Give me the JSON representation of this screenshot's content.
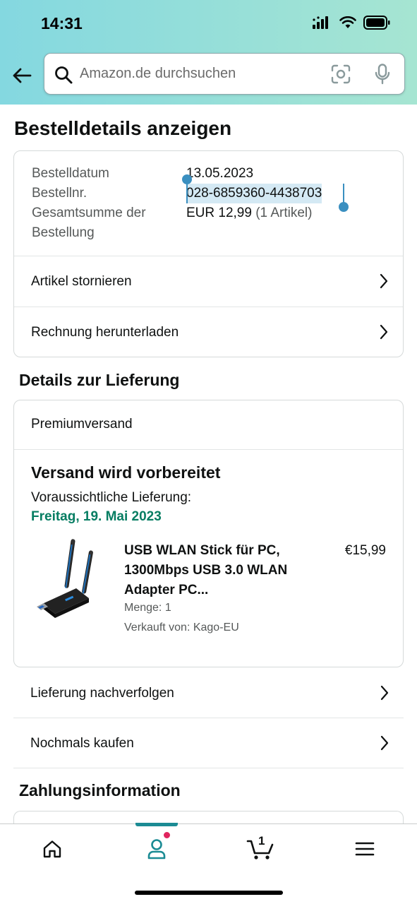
{
  "status_bar": {
    "time": "14:31"
  },
  "search": {
    "placeholder": "Amazon.de durchsuchen"
  },
  "page": {
    "title": "Bestelldetails anzeigen"
  },
  "order_summary": {
    "date_label": "Bestelldatum",
    "date_value": "13.05.2023",
    "number_label": "Bestellnr.",
    "number_value": "028-6859360-4438703",
    "total_label_line1": "Gesamtsumme der",
    "total_label_line2": "Bestellung",
    "total_value": "EUR 12,99",
    "total_items": "(1 Artikel)",
    "actions": [
      {
        "label": "Artikel stornieren"
      },
      {
        "label": "Rechnung herunterladen"
      }
    ]
  },
  "delivery": {
    "section_title": "Details zur Lieferung",
    "shipping_type": "Premiumversand",
    "status": "Versand wird vorbereitet",
    "eta_label": "Voraussichtliche Lieferung:",
    "eta_date": "Freitag, 19. Mai 2023",
    "item": {
      "title": "USB WLAN Stick für PC, 1300Mbps USB 3.0 WLAN Adapter PC...",
      "price": "€15,99",
      "quantity": "Menge: 1",
      "seller": "Verkauft von: Kago-EU"
    },
    "actions": [
      {
        "label": "Lieferung nachverfolgen"
      },
      {
        "label": "Nochmals kaufen"
      }
    ]
  },
  "payment": {
    "section_title": "Zahlungsinformation"
  },
  "tabbar": {
    "items": [
      {
        "icon": "home-icon"
      },
      {
        "icon": "user-icon",
        "active": true
      },
      {
        "icon": "cart-icon",
        "count": "1"
      },
      {
        "icon": "menu-icon"
      }
    ]
  },
  "colors": {
    "accent": "#1b8b94",
    "success": "#067d62",
    "selection": "#3a8fc0",
    "notify": "#e0245e"
  }
}
